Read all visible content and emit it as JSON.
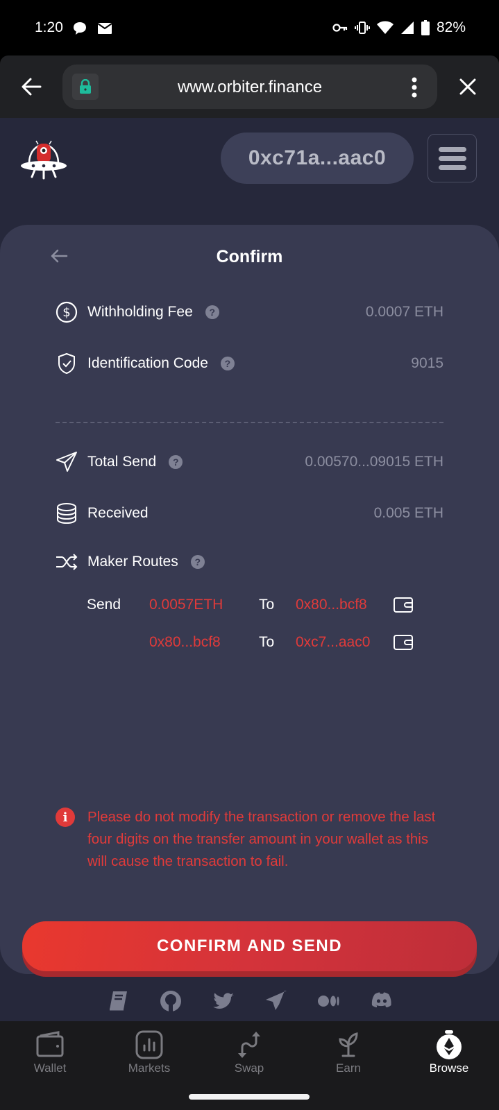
{
  "status_bar": {
    "time": "1:20",
    "battery": "82%",
    "left_icons": [
      "chat-bubble-icon",
      "mail-icon"
    ],
    "right_icons": [
      "key-icon",
      "vibrate-icon",
      "wifi-icon",
      "signal-icon",
      "battery-icon"
    ]
  },
  "browser": {
    "url": "www.orbiter.finance",
    "icons": [
      "back-arrow-icon",
      "lock-icon",
      "more-vert-icon",
      "close-icon"
    ],
    "colors": {
      "lock": "#1ebc9c"
    }
  },
  "header": {
    "wallet_address": "0xc71a...aac0",
    "logo": "orbiter-ufo-logo"
  },
  "confirm": {
    "title": "Confirm",
    "rows": [
      {
        "icon": "dollar-circle-icon",
        "label": "Withholding Fee",
        "help": "?",
        "value": "0.0007 ETH"
      },
      {
        "icon": "shield-check-icon",
        "label": "Identification Code",
        "help": "?",
        "value": "9015"
      },
      {
        "icon": "paper-plane-icon",
        "label": "Total Send",
        "help": "?",
        "value": "0.00570...09015 ETH"
      },
      {
        "icon": "coins-stack-icon",
        "label": "Received",
        "value": "0.005 ETH"
      },
      {
        "icon": "shuffle-icon",
        "label": "Maker Routes",
        "help": "?"
      }
    ],
    "routes": [
      {
        "prefix": "Send",
        "from": "0.0057ETH",
        "to_label": "To",
        "to": "0x80...bcf8"
      },
      {
        "prefix": "",
        "from": "0x80...bcf8",
        "to_label": "To",
        "to": "0xc7...aac0"
      }
    ],
    "warning": "Please do not modify the transaction or remove the last four digits on the transfer amount in your wallet as this will cause the transaction to fail.",
    "warning_icon": "i",
    "button_label": "CONFIRM AND SEND",
    "colors": {
      "accent": "#e03a3a",
      "card": "#383a51",
      "page": "#26283b"
    }
  },
  "socials": [
    "docs-book-icon",
    "github-icon",
    "twitter-icon",
    "telegram-icon",
    "medium-icon",
    "discord-icon"
  ],
  "bottom_nav": [
    {
      "label": "Wallet",
      "icon": "wallet-icon",
      "active": false
    },
    {
      "label": "Markets",
      "icon": "chart-bars-icon",
      "active": false
    },
    {
      "label": "Swap",
      "icon": "swap-arrows-icon",
      "active": false
    },
    {
      "label": "Earn",
      "icon": "sprout-icon",
      "active": false
    },
    {
      "label": "Browse",
      "icon": "ethereum-compass-icon",
      "active": true
    }
  ]
}
